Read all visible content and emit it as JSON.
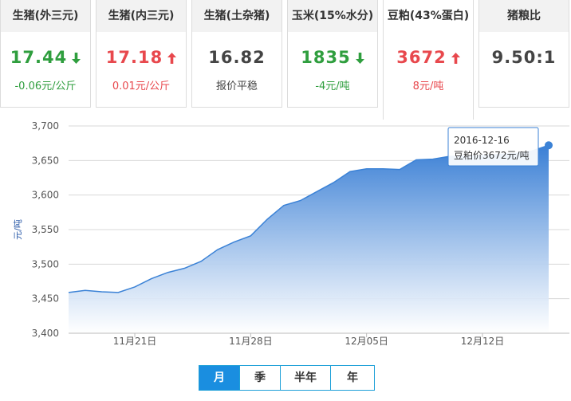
{
  "cards": [
    {
      "title": "生猪(外三元)",
      "value": "17.44",
      "dir": "down",
      "sub": "-0.06元/公斤"
    },
    {
      "title": "生猪(内三元)",
      "value": "17.18",
      "dir": "up",
      "sub": "0.01元/公斤"
    },
    {
      "title": "生猪(土杂猪)",
      "value": "16.82",
      "dir": "flat",
      "sub": "报价平稳"
    },
    {
      "title": "玉米(15%水分)",
      "value": "1835",
      "dir": "down",
      "sub": "-4元/吨"
    },
    {
      "title": "豆粕(43%蛋白)",
      "value": "3672",
      "dir": "up",
      "sub": "8元/吨"
    },
    {
      "title": "猪粮比",
      "value": "9.50:1",
      "dir": "flat",
      "sub": ""
    }
  ],
  "colors": {
    "up": "#e8484d",
    "down": "#2f9e3e",
    "accent": "#1a8ee0",
    "line": "#3b82d6"
  },
  "range_buttons": [
    "月",
    "季",
    "半年",
    "年"
  ],
  "selected_range": "月",
  "chart_data": {
    "type": "area",
    "title": "",
    "xlabel": "",
    "ylabel": "元/吨",
    "ylim": [
      3400,
      3700
    ],
    "yticks": [
      "3,400",
      "3,450",
      "3,500",
      "3,550",
      "3,600",
      "3,650",
      "3,700"
    ],
    "xticks": [
      "11月21日",
      "11月28日",
      "12月05日",
      "12月12日"
    ],
    "x": [
      "2016-11-17",
      "2016-11-18",
      "2016-11-19",
      "2016-11-20",
      "2016-11-21",
      "2016-11-22",
      "2016-11-23",
      "2016-11-24",
      "2016-11-25",
      "2016-11-26",
      "2016-11-27",
      "2016-11-28",
      "2016-11-29",
      "2016-11-30",
      "2016-12-01",
      "2016-12-02",
      "2016-12-03",
      "2016-12-04",
      "2016-12-05",
      "2016-12-06",
      "2016-12-07",
      "2016-12-08",
      "2016-12-09",
      "2016-12-10",
      "2016-12-11",
      "2016-12-12",
      "2016-12-13",
      "2016-12-14",
      "2016-12-15",
      "2016-12-16"
    ],
    "values": [
      3459,
      3462,
      3460,
      3459,
      3467,
      3479,
      3488,
      3494,
      3504,
      3521,
      3532,
      3541,
      3565,
      3585,
      3592,
      3605,
      3618,
      3634,
      3638,
      3638,
      3637,
      3651,
      3652,
      3656,
      3656,
      3657,
      3659,
      3660,
      3664,
      3672
    ],
    "grid": true,
    "legend": "none",
    "tooltip": {
      "date": "2016-12-16",
      "text": "豆粕价3672元/吨"
    }
  }
}
